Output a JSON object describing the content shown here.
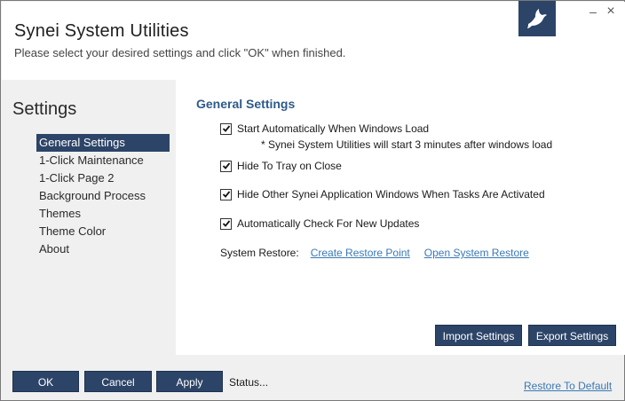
{
  "header": {
    "title": "Synei System Utilities",
    "subtitle": "Please select your desired settings and click \"OK\" when finished.",
    "logo_icon": "dove-icon",
    "minimize_symbol": "‒",
    "close_symbol": "×"
  },
  "sidebar": {
    "heading": "Settings",
    "items": [
      {
        "label": "General Settings",
        "active": true
      },
      {
        "label": "1-Click Maintenance",
        "active": false
      },
      {
        "label": "1-Click Page 2",
        "active": false
      },
      {
        "label": "Background Process",
        "active": false
      },
      {
        "label": "Themes",
        "active": false
      },
      {
        "label": "Theme Color",
        "active": false
      },
      {
        "label": "About",
        "active": false
      }
    ]
  },
  "content": {
    "section_title": "General Settings",
    "options": [
      {
        "label": "Start Automatically When Windows Load",
        "checked": true
      },
      {
        "label": "Hide To Tray on Close",
        "checked": true
      },
      {
        "label": "Hide Other Synei Application Windows When Tasks Are Activated",
        "checked": true
      },
      {
        "label": "Automatically Check For New Updates",
        "checked": true
      }
    ],
    "startup_note": "* Synei System Utilities will start 3 minutes after windows load",
    "system_restore": {
      "label": "System Restore:",
      "create_link": "Create Restore Point",
      "open_link": "Open System Restore"
    },
    "import_label": "Import Settings",
    "export_label": "Export Settings"
  },
  "footer": {
    "ok_label": "OK",
    "cancel_label": "Cancel",
    "apply_label": "Apply",
    "status_text": "Status...",
    "restore_default_label": "Restore To Default"
  },
  "colors": {
    "accent": "#2c4468",
    "section_title": "#2f5a8a",
    "link": "#3a78b5"
  }
}
